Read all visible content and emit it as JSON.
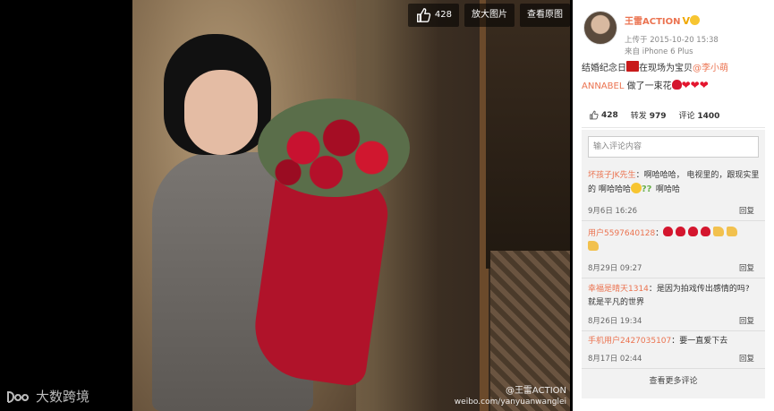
{
  "photo": {
    "like_count": "428",
    "zoom_label": "放大图片",
    "original_label": "查看原图",
    "watermark_user": "@王雷ACTION",
    "watermark_url": "weibo.com/yanyuanwanglei"
  },
  "brand": {
    "text": "大数跨境"
  },
  "post": {
    "username": "王雷ACTION",
    "uploaded": "上传于 2015-10-20 15:38",
    "device": "来自 iPhone 6 Plus",
    "text_a": "结婚纪念日",
    "text_b": "在现场为宝贝",
    "mention": "@李小萌ANNABEL",
    "text_c": " 做了一束花"
  },
  "stats": {
    "likes": "428",
    "repost_label": "转发",
    "reposts": "979",
    "comment_label": "评论",
    "comments": "1400"
  },
  "comments": {
    "placeholder": "输入评论内容",
    "reply_label": "回复",
    "more_label": "查看更多评论",
    "items": [
      {
        "user": "坏孩子JK先生",
        "text_a": "：啊哈哈哈， 电视里的，跟现实里的 啊哈哈哈",
        "text_b": "啊哈哈",
        "date": "9月6日 16:26"
      },
      {
        "user": "用户5597640128",
        "text_a": "：",
        "text_b": "",
        "date": "8月29日 09:27"
      },
      {
        "user": "幸福是晴天1314",
        "text_a": "：是因为拍戏传出感情的吗? 就是平凡的世界",
        "text_b": "",
        "date": "8月26日 19:34"
      },
      {
        "user": "手机用户2427035107",
        "text_a": "：要一直爱下去",
        "text_b": "",
        "date": "8月17日 02:44"
      }
    ]
  },
  "colors": {
    "link": "#eb7350",
    "panel_bg": "#f2f2f2"
  }
}
